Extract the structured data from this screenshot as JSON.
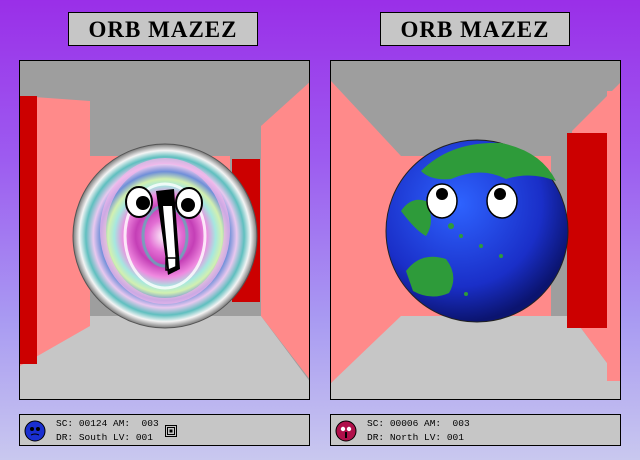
{
  "players": [
    {
      "title": "ORB MAZEZ",
      "orb": "swirl-face-orb",
      "status": {
        "score_label": "SC:",
        "score": "00124",
        "ammo_label": "AM:",
        "ammo": "003",
        "dir_label": "DR:",
        "direction": "South",
        "level_label": "LV:",
        "level": "001"
      },
      "avatar_icon": "blue-orb-avatar-icon",
      "extra_icon": "maze-map-icon"
    },
    {
      "title": "ORB MAZEZ",
      "orb": "earth-face-orb",
      "status": {
        "score_label": "SC:",
        "score": "00006",
        "ammo_label": "AM:",
        "ammo": "003",
        "dir_label": "DR:",
        "direction": "North",
        "level_label": "LV:",
        "level": "001"
      },
      "avatar_icon": "red-orb-avatar-icon"
    }
  ],
  "colors": {
    "ceiling": "#9e9e9e",
    "floor": "#c6c6c6",
    "wall_pink": "#ff8a8a",
    "wall_red": "#cc0000"
  }
}
